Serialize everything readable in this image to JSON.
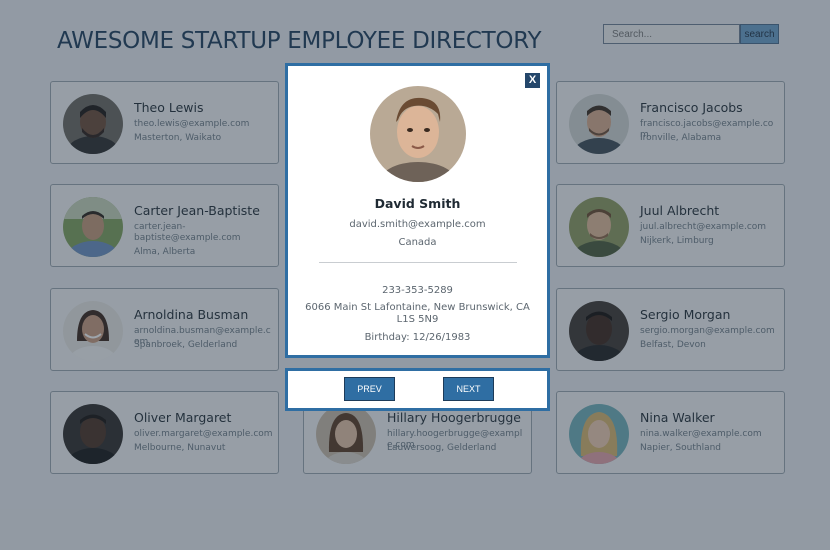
{
  "page_title": "AWESOME STARTUP EMPLOYEE DIRECTORY",
  "search": {
    "placeholder": "Search...",
    "button_label": "search"
  },
  "employees": [
    {
      "name": "Theo Lewis",
      "email": "theo.lewis@example.com",
      "location": "Masterton, Waikato"
    },
    {
      "name": "Francisco Jacobs",
      "email": "francisco.jacobs@example.com",
      "location": "Ironville, Alabama"
    },
    {
      "name": "Carter Jean-Baptiste",
      "email": "carter.jean-baptiste@example.com",
      "location": "Alma, Alberta"
    },
    {
      "name": "Juul Albrecht",
      "email": "juul.albrecht@example.com",
      "location": "Nijkerk, Limburg"
    },
    {
      "name": "Arnoldina Busman",
      "email": "arnoldina.busman@example.com",
      "location": "Spanbroek, Gelderland"
    },
    {
      "name": "Sergio Morgan",
      "email": "sergio.morgan@example.com",
      "location": "Belfast, Devon"
    },
    {
      "name": "Oliver Margaret",
      "email": "oliver.margaret@example.com",
      "location": "Melbourne, Nunavut"
    },
    {
      "name": "Hillary Hoogerbrugge",
      "email": "hillary.hoogerbrugge@example.com",
      "location": "Lauwersoog, Gelderland"
    },
    {
      "name": "Nina Walker",
      "email": "nina.walker@example.com",
      "location": "Napier, Southland"
    }
  ],
  "modal": {
    "close_label": "X",
    "name": "David Smith",
    "email": "david.smith@example.com",
    "country": "Canada",
    "phone": "233-353-5289",
    "address": "6066 Main St Lafontaine, New Brunswick, CA L1S 5N9",
    "birthday": "Birthday: 12/26/1983"
  },
  "nav": {
    "prev_label": "PREV",
    "next_label": "NEXT"
  }
}
